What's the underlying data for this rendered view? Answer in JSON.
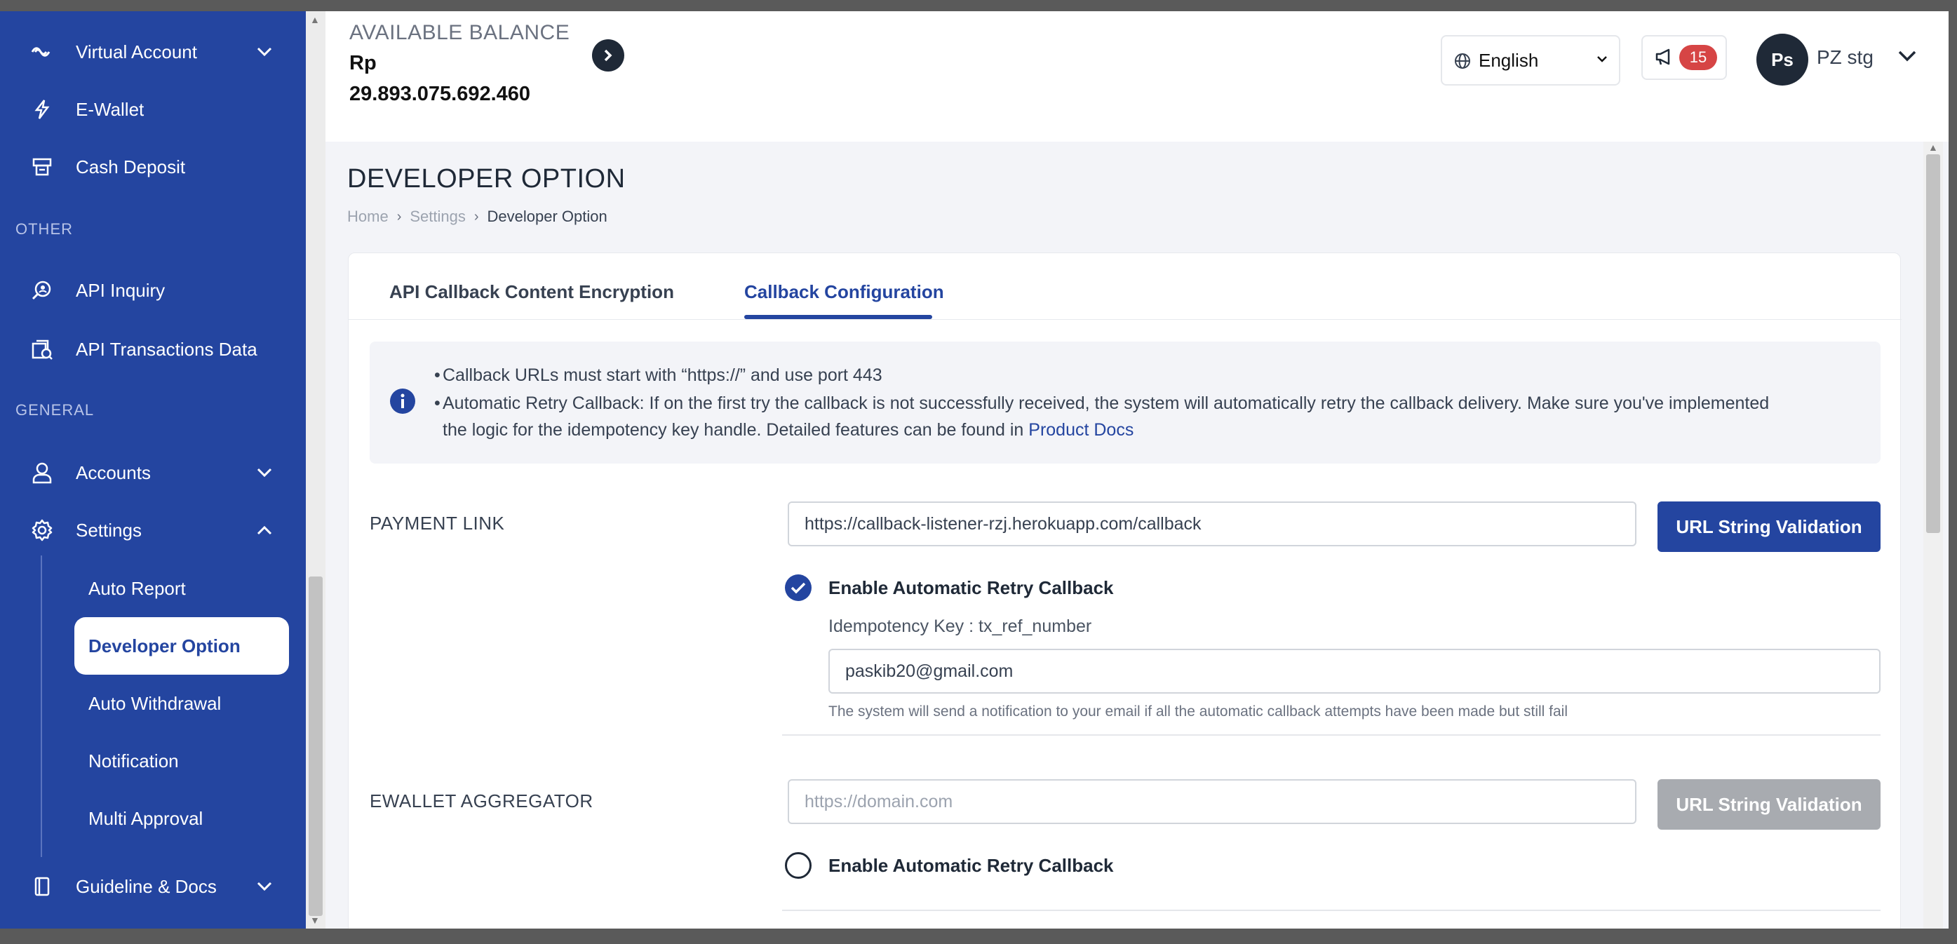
{
  "sidebar": {
    "items_top": [
      {
        "label": "Virtual Account",
        "icon": "virtual-account-icon",
        "has_chevron": true
      },
      {
        "label": "E-Wallet",
        "icon": "ewallet-icon"
      },
      {
        "label": "Cash Deposit",
        "icon": "cash-deposit-icon"
      }
    ],
    "section_other": "OTHER",
    "items_other": [
      {
        "label": "API Inquiry",
        "icon": "api-inquiry-icon"
      },
      {
        "label": "API Transactions Data",
        "icon": "api-transactions-icon"
      }
    ],
    "section_general": "GENERAL",
    "accounts": {
      "label": "Accounts",
      "icon": "user-icon"
    },
    "settings": {
      "label": "Settings",
      "icon": "gear-icon"
    },
    "settings_sub": [
      {
        "label": "Auto Report"
      },
      {
        "label": "Developer Option",
        "active": true
      },
      {
        "label": "Auto Withdrawal"
      },
      {
        "label": "Notification"
      },
      {
        "label": "Multi Approval"
      }
    ],
    "guideline": {
      "label": "Guideline & Docs",
      "icon": "book-icon"
    }
  },
  "header": {
    "balance_label": "AVAILABLE BALANCE",
    "balance_currency": "Rp",
    "balance_value": "29.893.075.692.460",
    "language": "English",
    "notification_count": "15",
    "avatar_initials": "Ps",
    "user_name": "PZ stg"
  },
  "page": {
    "title": "DEVELOPER OPTION",
    "breadcrumb": [
      "Home",
      "Settings",
      "Developer Option"
    ],
    "tabs": [
      {
        "label": "API Callback Content Encryption"
      },
      {
        "label": "Callback Configuration",
        "active": true
      }
    ],
    "info": {
      "line1": "Callback URLs must start with “https://” and use port 443",
      "line2": "Automatic Retry Callback: If on the first try the callback is not successfully received, the system will automatically retry the callback delivery. Make sure you've implemented",
      "line3": "the logic for the idempotency key handle. Detailed features can be found in ",
      "link": "Product Docs"
    },
    "payment_link": {
      "label": "PAYMENT LINK",
      "url_value": "https://callback-listener-rzj.herokuapp.com/callback",
      "validate_label": "URL String Validation",
      "retry_label": "Enable Automatic Retry Callback",
      "retry_enabled": true,
      "idempotency": "Idempotency Key : tx_ref_number",
      "email_value": "paskib20@gmail.com",
      "help": "The system will send a notification to your email if all the automatic callback attempts have been made but still fail"
    },
    "ewallet": {
      "label": "EWALLET AGGREGATOR",
      "url_placeholder": "https://domain.com",
      "validate_label": "URL String Validation",
      "retry_label": "Enable Automatic Retry Callback",
      "retry_enabled": false
    }
  },
  "colors": {
    "primary": "#2445a0",
    "badge": "#d64545",
    "disabled": "#a8abb0"
  }
}
